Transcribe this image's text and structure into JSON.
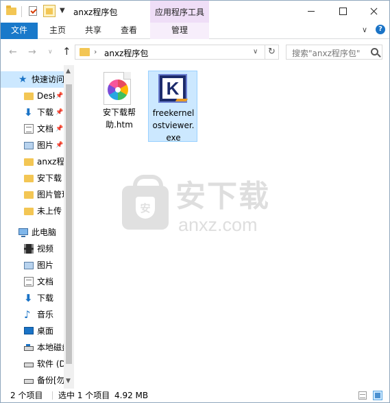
{
  "window": {
    "title": "anxz程序包",
    "context_tab_group": "应用程序工具"
  },
  "ribbon": {
    "tabs": [
      {
        "label": "文件"
      },
      {
        "label": "主页"
      },
      {
        "label": "共享"
      },
      {
        "label": "查看"
      },
      {
        "label": "管理"
      }
    ]
  },
  "address": {
    "path": "anxz程序包",
    "search_placeholder": "搜索\"anxz程序包\""
  },
  "nav": {
    "quick_access": "快速访问",
    "pinned": [
      {
        "label": "Desktop",
        "icon": "folder-icon"
      },
      {
        "label": "下载",
        "icon": "download-icon"
      },
      {
        "label": "文档",
        "icon": "document-icon"
      },
      {
        "label": "图片",
        "icon": "picture-icon"
      }
    ],
    "recent": [
      {
        "label": "anxz程序包",
        "icon": "folder-icon"
      },
      {
        "label": "安下载",
        "icon": "folder-icon"
      },
      {
        "label": "图片管理",
        "icon": "folder-icon"
      },
      {
        "label": "未上传",
        "icon": "folder-icon"
      }
    ],
    "this_pc": "此电脑",
    "pc_items": [
      {
        "label": "视频",
        "icon": "video-icon"
      },
      {
        "label": "图片",
        "icon": "picture-icon"
      },
      {
        "label": "文档",
        "icon": "document-icon"
      },
      {
        "label": "下载",
        "icon": "download-icon"
      },
      {
        "label": "音乐",
        "icon": "music-icon"
      },
      {
        "label": "桌面",
        "icon": "desktop-icon"
      },
      {
        "label": "本地磁盘",
        "icon": "local-disk-icon"
      },
      {
        "label": "软件 (D",
        "icon": "drive-icon"
      },
      {
        "label": "备份[勿",
        "icon": "drive-icon"
      }
    ]
  },
  "files": [
    {
      "name": "安下载帮助.htm",
      "icon": "htm-file-icon",
      "selected": false
    },
    {
      "name": "freekernelostviewer.exe",
      "icon": "kernel-app-icon",
      "selected": true
    }
  ],
  "watermark": {
    "cn": "安下载",
    "en": "anxz.com",
    "shield": "安"
  },
  "status": {
    "count": "2 个项目",
    "selection": "选中 1 个项目",
    "size": "4.92 MB"
  },
  "colors": {
    "accent": "#1979ca",
    "context_tab": "#efdef7",
    "selection": "#cce8ff"
  }
}
